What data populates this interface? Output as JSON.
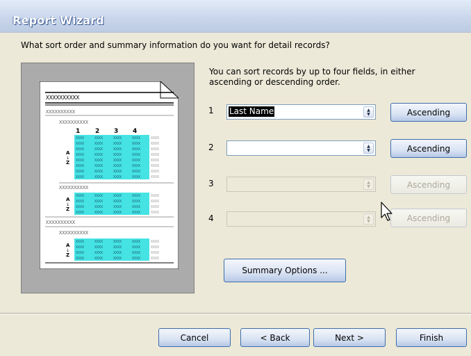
{
  "window": {
    "title": "Report Wizard"
  },
  "question": "What sort order and summary information do you want for detail records?",
  "intro": "You can sort records by up to four fields, in either ascending or descending order.",
  "preview": {
    "placeholder": "XXXXXXXXXX",
    "cell": "XXXX",
    "columns": [
      "1",
      "2",
      "3",
      "4"
    ],
    "sort_glyph_top": "A",
    "sort_glyph_arrow": "↓",
    "sort_glyph_bottom": "Z",
    "highlight_color": "#45e3e3"
  },
  "sort_rows": [
    {
      "number": "1",
      "field": "Last Name",
      "order": "Ascending",
      "enabled": true
    },
    {
      "number": "2",
      "field": "",
      "order": "Ascending",
      "enabled": true
    },
    {
      "number": "3",
      "field": "",
      "order": "Ascending",
      "enabled": false
    },
    {
      "number": "4",
      "field": "",
      "order": "Ascending",
      "enabled": false
    }
  ],
  "buttons": {
    "summary": "Summary Options ...",
    "cancel": "Cancel",
    "back": "< Back",
    "next": "Next >",
    "finish": "Finish"
  },
  "icons": {
    "dropdown": "chevron-down-icon",
    "cursor": "mouse-pointer-icon"
  }
}
